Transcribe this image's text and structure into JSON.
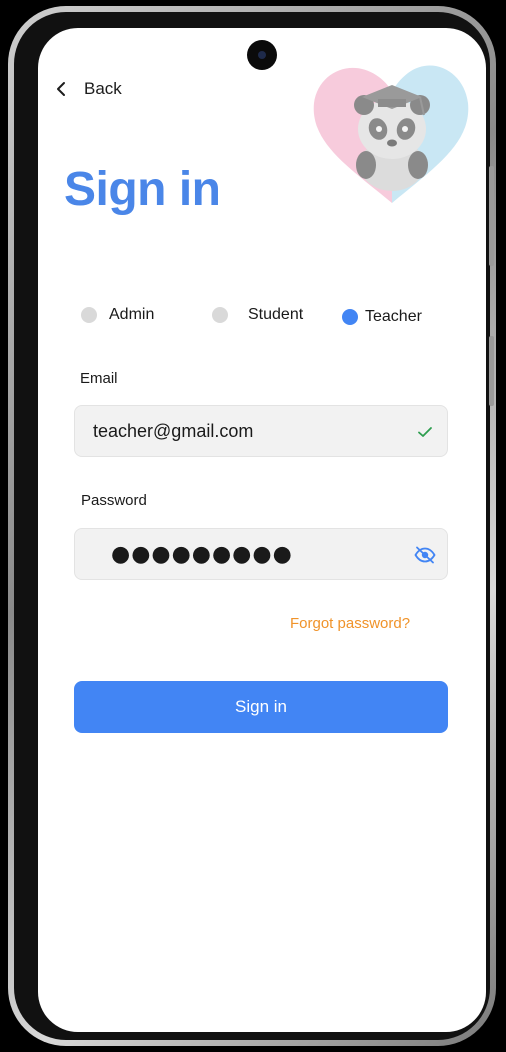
{
  "nav": {
    "back_label": "Back"
  },
  "header": {
    "title": "Sign in"
  },
  "roles": {
    "items": [
      {
        "label": "Admin",
        "selected": false
      },
      {
        "label": "Student",
        "selected": false
      },
      {
        "label": "Teacher",
        "selected": true
      }
    ]
  },
  "form": {
    "email_label": "Email",
    "email_value": "teacher@gmail.com",
    "password_label": "Password",
    "password_mask": "●●●●●●●●●",
    "forgot_label": "Forgot password?",
    "submit_label": "Sign in"
  },
  "colors": {
    "accent": "#4285f4",
    "title": "#4a86e8",
    "link": "#f0932a",
    "valid": "#2e9e4f",
    "radio_off": "#d9d9d9"
  },
  "icons": {
    "back": "chevron-left-icon",
    "email_status": "check-icon",
    "password_toggle": "eye-off-icon",
    "logo": "panda-logo"
  }
}
